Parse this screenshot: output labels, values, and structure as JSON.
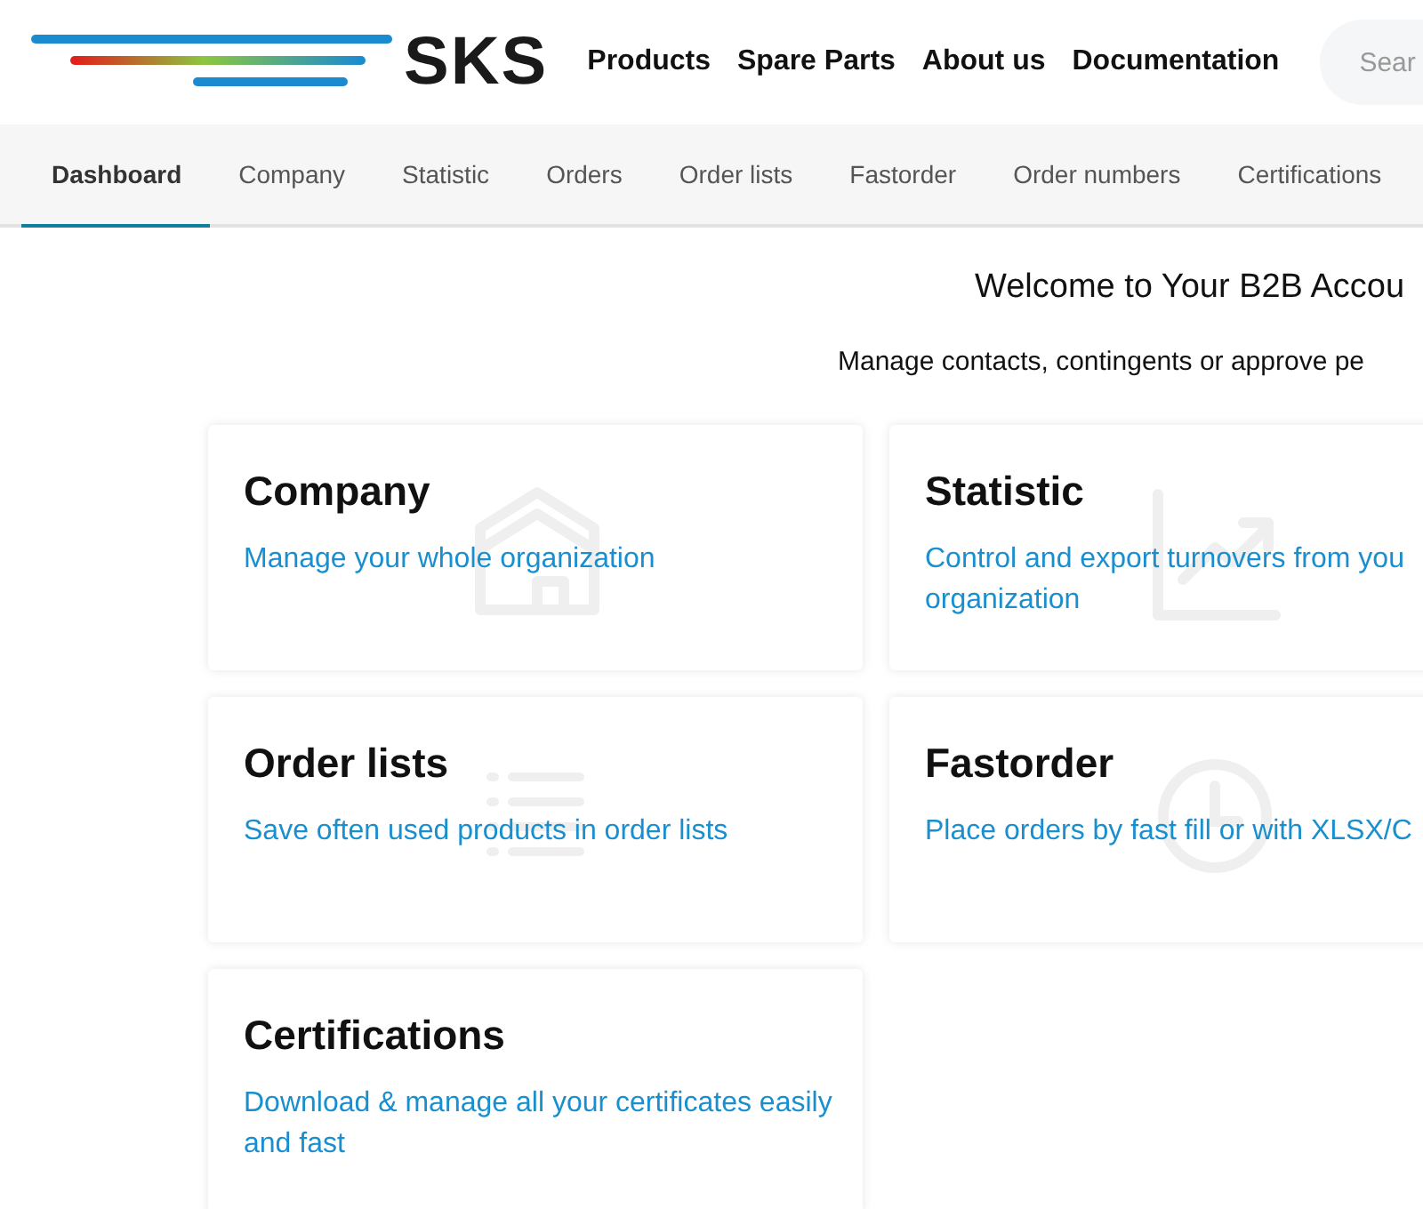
{
  "header": {
    "logo": "SKS",
    "nav": [
      "Products",
      "Spare Parts",
      "About us",
      "Documentation"
    ],
    "search": {
      "placeholder": "Sear"
    }
  },
  "tabs": [
    {
      "label": "Dashboard",
      "selected": true
    },
    {
      "label": "Company",
      "selected": false
    },
    {
      "label": "Statistic",
      "selected": false
    },
    {
      "label": "Orders",
      "selected": false
    },
    {
      "label": "Order lists",
      "selected": false
    },
    {
      "label": "Fastorder",
      "selected": false
    },
    {
      "label": "Order numbers",
      "selected": false
    },
    {
      "label": "Certifications",
      "selected": false
    }
  ],
  "welcome": {
    "title": "Welcome to Your B2B Accou",
    "subtitle": "Manage contacts, contingents or approve pe"
  },
  "cards": [
    {
      "kind": "house",
      "title": "Company",
      "text": "Manage your whole organization"
    },
    {
      "kind": "chart",
      "title": "Statistic",
      "text": "Control and export turnovers from you organization"
    },
    {
      "kind": "list",
      "title": "Order lists",
      "text": "Save often used products in order lists"
    },
    {
      "kind": "clock",
      "title": "Fastorder",
      "text": "Place orders by fast fill or with XLSX/C"
    },
    {
      "kind": "none",
      "title": "Certifications",
      "text": "Download & manage all your certificates easily and fast"
    }
  ]
}
